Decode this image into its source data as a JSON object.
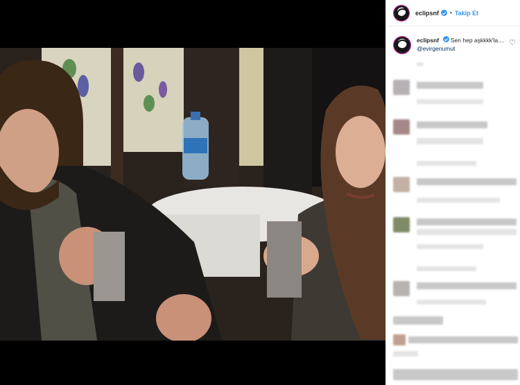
{
  "header": {
    "username": "eclipsnf",
    "separator": "•",
    "follow_label": "Takip Et"
  },
  "caption": {
    "username": "eclipsnf",
    "text": "Sen hep aşkkkk'la....",
    "mention": "@evirgenumut"
  },
  "icons": {
    "verified": "verified-badge-icon",
    "like": "heart-icon"
  },
  "colors": {
    "link_blue": "#3897f0",
    "text": "#262626",
    "background": "#ffffff",
    "media_bg": "#000000"
  }
}
